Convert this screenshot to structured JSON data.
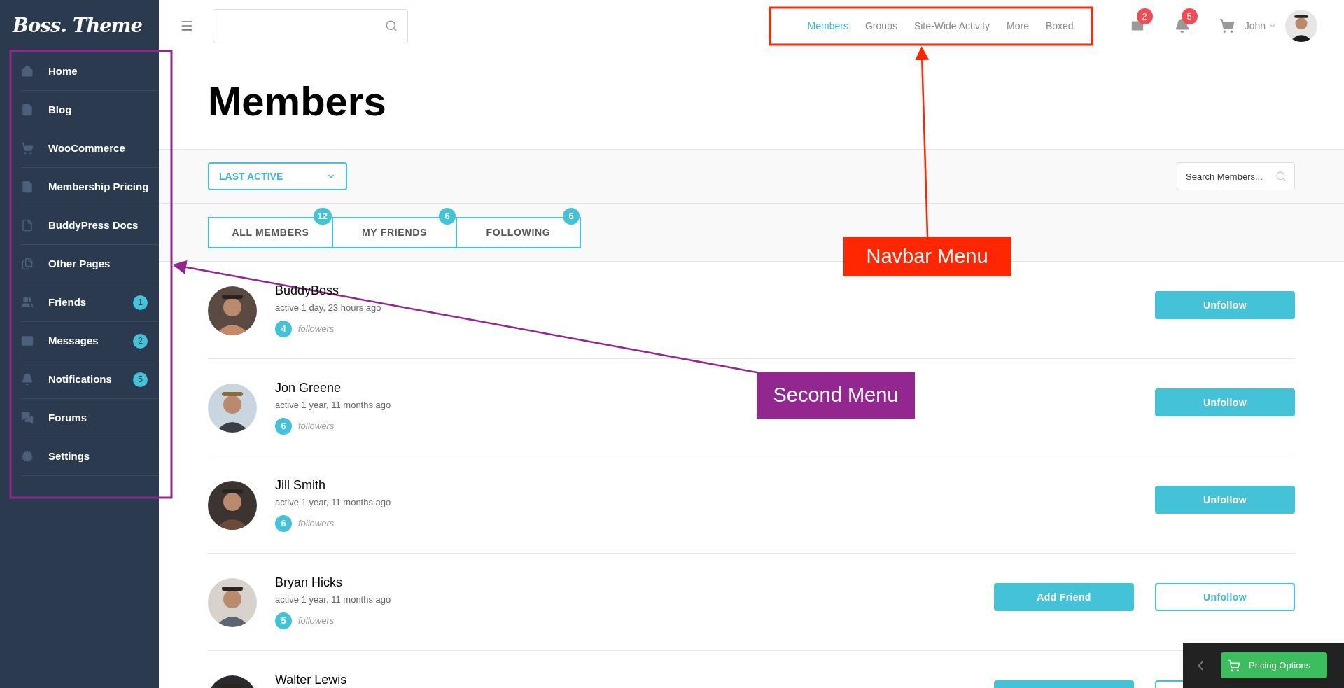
{
  "logo": "Boss. Theme",
  "sidebar": {
    "items": [
      {
        "label": "Home"
      },
      {
        "label": "Blog"
      },
      {
        "label": "WooCommerce"
      },
      {
        "label": "Membership Pricing"
      },
      {
        "label": "BuddyPress Docs"
      },
      {
        "label": "Other Pages"
      },
      {
        "label": "Friends",
        "badge": "1"
      },
      {
        "label": "Messages",
        "badge": "2"
      },
      {
        "label": "Notifications",
        "badge": "5"
      },
      {
        "label": "Forums"
      },
      {
        "label": "Settings"
      }
    ]
  },
  "header": {
    "nav": [
      {
        "label": "Members",
        "selected": true
      },
      {
        "label": "Groups",
        "selected": false
      },
      {
        "label": "Site-Wide Activity",
        "selected": false
      },
      {
        "label": "More",
        "selected": false
      },
      {
        "label": "Boxed",
        "selected": false
      }
    ],
    "messages_count": "2",
    "notifications_count": "5",
    "user_name": "John"
  },
  "page_title": "Members",
  "filter": {
    "value": "LAST ACTIVE"
  },
  "member_search": {
    "placeholder": "Search Members..."
  },
  "tabs": [
    {
      "label": "ALL MEMBERS",
      "count": "12"
    },
    {
      "label": "MY FRIENDS",
      "count": "6"
    },
    {
      "label": "FOLLOWING",
      "count": "6"
    }
  ],
  "members": [
    {
      "name": "BuddyBoss",
      "activity": "active 1 day, 23 hours ago",
      "followers": "4",
      "followers_label": "followers",
      "buttons": [
        {
          "label": "Unfollow",
          "kind": "filled"
        }
      ]
    },
    {
      "name": "Jon Greene",
      "activity": "active 1 year, 11 months ago",
      "followers": "6",
      "followers_label": "followers",
      "buttons": [
        {
          "label": "Unfollow",
          "kind": "filled"
        }
      ]
    },
    {
      "name": "Jill Smith",
      "activity": "active 1 year, 11 months ago",
      "followers": "6",
      "followers_label": "followers",
      "buttons": [
        {
          "label": "Unfollow",
          "kind": "filled"
        }
      ]
    },
    {
      "name": "Bryan Hicks",
      "activity": "active 1 year, 11 months ago",
      "followers": "5",
      "followers_label": "followers",
      "buttons": [
        {
          "label": "Add Friend",
          "kind": "filled"
        },
        {
          "label": "Unfollow",
          "kind": "outline"
        }
      ]
    },
    {
      "name": "Walter Lewis",
      "buttons": [
        {
          "kind": "filled"
        },
        {
          "kind": "outline"
        }
      ]
    }
  ],
  "pricing": {
    "label": "Pricing Options"
  },
  "annotations": [
    {
      "label": "Navbar Menu",
      "color": "#ff2600"
    },
    {
      "label": "Second Menu",
      "color": "#92278f"
    }
  ]
}
